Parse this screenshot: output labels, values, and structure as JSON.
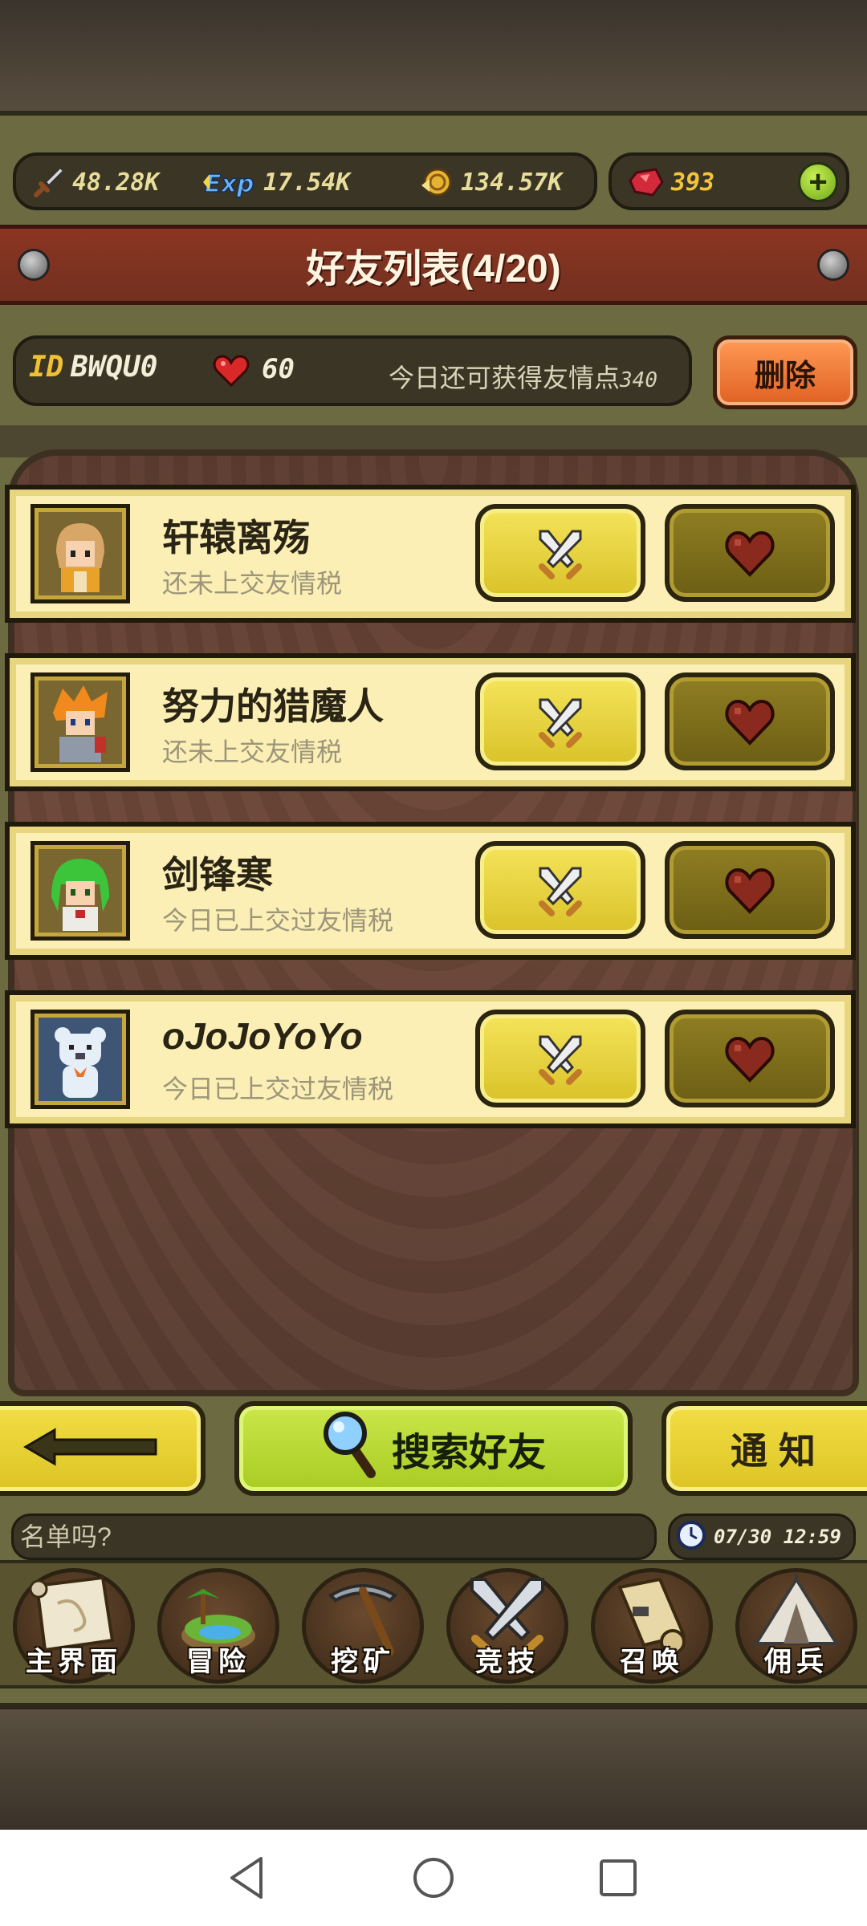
{
  "resources": {
    "attack": {
      "icon": "sword-icon",
      "value": "48.28K"
    },
    "exp": {
      "icon": "exp-icon",
      "value": "17.54K"
    },
    "gold": {
      "icon": "gold-coin-icon",
      "value": "134.57K"
    },
    "gems": {
      "icon": "ruby-gem-icon",
      "value": "393"
    }
  },
  "banner": {
    "title": "好友列表(4/20)"
  },
  "idrow": {
    "id_label": "ID",
    "id_value": "BWQU0",
    "hearts": "60",
    "friendship_text": "今日还可获得友情点",
    "friendship_points": "340",
    "delete_label": "删除"
  },
  "friends": [
    {
      "name": "轩辕离殇",
      "status": "还未上交友情税",
      "avatar": "avatar-blonde-hero"
    },
    {
      "name": "努力的猎魔人",
      "status": "还未上交友情税",
      "avatar": "avatar-orange-hair-knight"
    },
    {
      "name": "剑锋寒",
      "status": "今日已上交过友情税",
      "avatar": "avatar-green-hair-girl"
    },
    {
      "name": "oJoJoYoYo",
      "status": "今日已上交过友情税",
      "avatar": "avatar-white-bear"
    }
  ],
  "actions": {
    "back_icon": "arrow-left-icon",
    "search_label": "搜索好友",
    "notify_label": "通知"
  },
  "chat": {
    "text": "名单吗?"
  },
  "clock": {
    "time": "07/30 12:59"
  },
  "nav": [
    {
      "label": "主界面",
      "icon": "map-scroll-icon"
    },
    {
      "label": "冒险",
      "icon": "island-icon"
    },
    {
      "label": "挖矿",
      "icon": "pickaxe-icon"
    },
    {
      "label": "竞技",
      "icon": "crossed-swords-icon"
    },
    {
      "label": "召唤",
      "icon": "summon-scroll-icon"
    },
    {
      "label": "佣兵",
      "icon": "tent-icon"
    }
  ],
  "colors": {
    "banner": "#8b3522",
    "card": "#fbefb6",
    "fight_button": "#f5e45a",
    "gift_button": "#8f7e22",
    "search_button": "#cbe64a",
    "delete_button": "#ff9a54"
  }
}
